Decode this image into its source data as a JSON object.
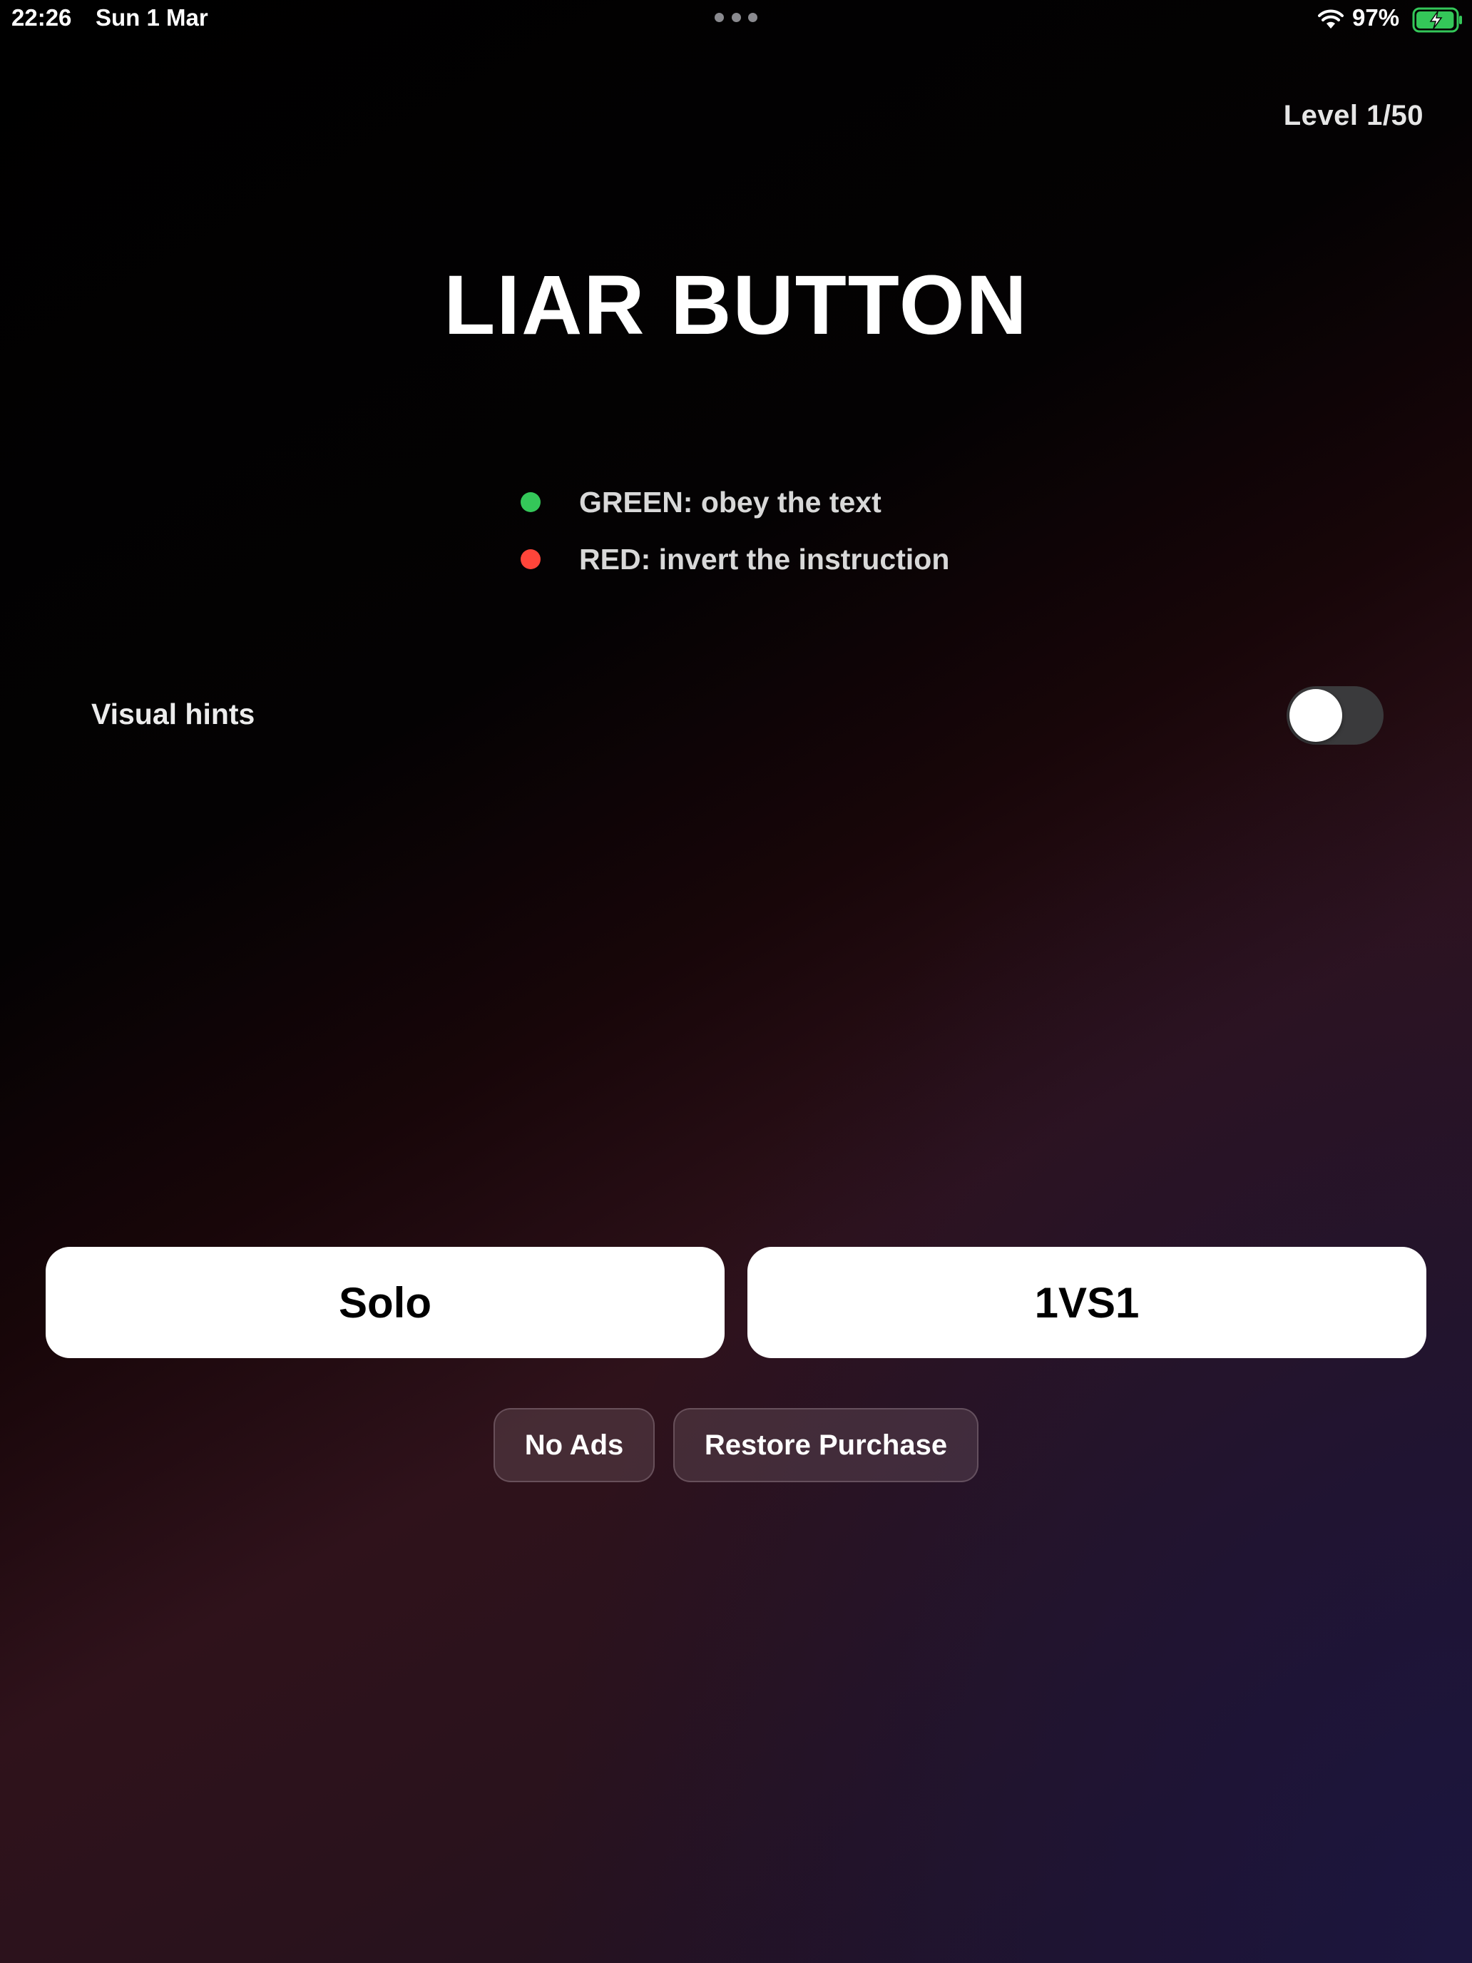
{
  "status_bar": {
    "time": "22:26",
    "date": "Sun 1 Mar",
    "battery_percent": "97%",
    "wifi_icon": "wifi-icon",
    "battery_icon": "battery-charging-icon",
    "battery_level": 0.97,
    "multitask_icon": "multitask-dots-icon"
  },
  "header": {
    "level": "Level 1/50"
  },
  "title": "LIAR BUTTON",
  "rules": [
    {
      "text": "GREEN: obey the text",
      "color": "#34c759"
    },
    {
      "text": "RED: invert the instruction",
      "color": "#ff453a"
    }
  ],
  "settings": {
    "visual_hints_label": "Visual hints",
    "visual_hints_on": false
  },
  "modes": {
    "solo_label": "Solo",
    "versus_label": "1VS1"
  },
  "store": {
    "no_ads_label": "No Ads",
    "restore_label": "Restore Purchase"
  }
}
